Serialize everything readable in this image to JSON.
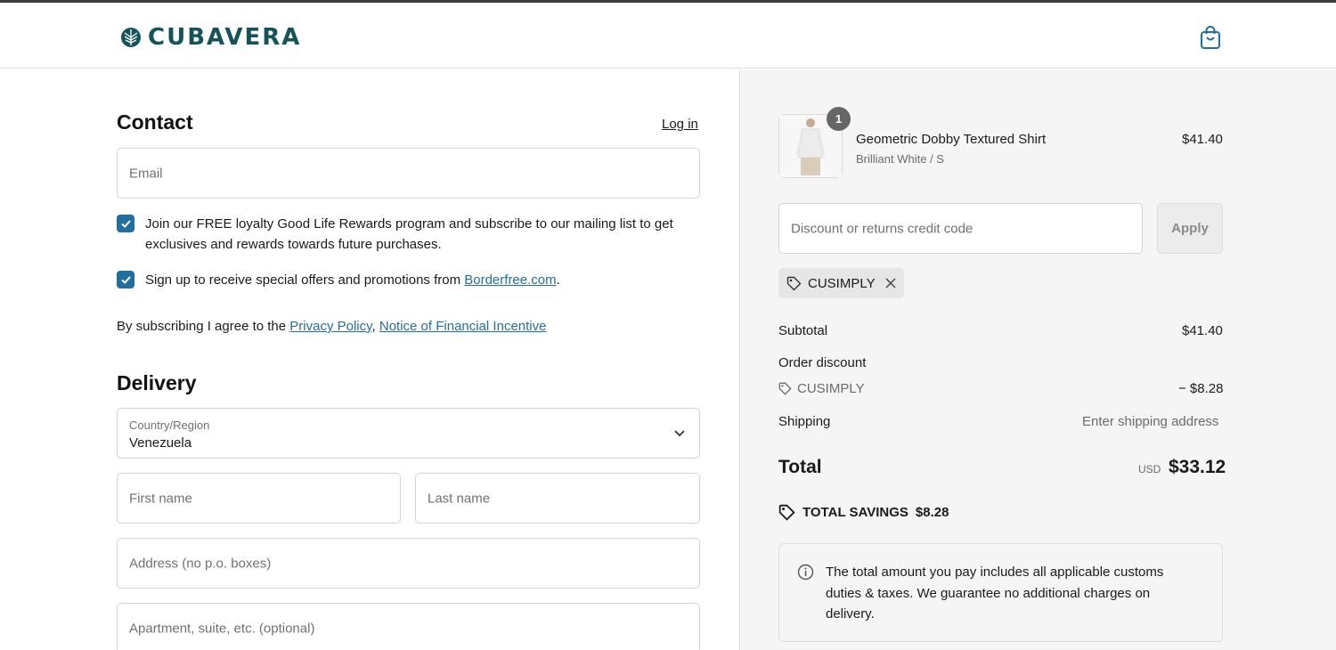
{
  "brand": {
    "name": "CUBAVERA",
    "logo_icon": "palm-leaf-icon",
    "accent": "#1f6f9f",
    "brand_color": "#14535a"
  },
  "header": {
    "cart_icon": "shopping-bag-icon"
  },
  "contact": {
    "title": "Contact",
    "login_label": "Log in",
    "email_placeholder": "Email",
    "loyalty_text": "Join our FREE loyalty Good Life Rewards program and subscribe to our mailing list to get exclusives and rewards towards future purchases.",
    "loyalty_checked": true,
    "offers_text_prefix": "Sign up to receive special offers and promotions from ",
    "offers_link": "Borderfree.com",
    "offers_text_suffix": ".",
    "offers_checked": true,
    "agree_prefix": "By subscribing I agree to the ",
    "privacy_link": "Privacy Policy",
    "separator": ",",
    "financial_link": "Notice of Financial Incentive"
  },
  "delivery": {
    "title": "Delivery",
    "country_label": "Country/Region",
    "country_value": "Venezuela",
    "first_name_placeholder": "First name",
    "last_name_placeholder": "Last name",
    "address_placeholder": "Address (no p.o. boxes)",
    "apartment_placeholder": "Apartment, suite, etc. (optional)"
  },
  "summary": {
    "item": {
      "name": "Geometric Dobby Textured Shirt",
      "variant": "Brilliant White / S",
      "price": "$41.40",
      "quantity": "1"
    },
    "discount_placeholder": "Discount or returns credit code",
    "apply_label": "Apply",
    "applied_code": "CUSIMPLY",
    "subtotal_label": "Subtotal",
    "subtotal_value": "$41.40",
    "order_discount_label": "Order discount",
    "discount_code": "CUSIMPLY",
    "discount_value": "− $8.28",
    "shipping_label": "Shipping",
    "shipping_value": "Enter shipping address",
    "total_label": "Total",
    "total_currency": "USD",
    "total_value": "$33.12",
    "savings_label": "TOTAL SAVINGS",
    "savings_value": "$8.28",
    "notice_text": "The total amount you pay includes all applicable customs duties & taxes. We guarantee no additional charges on delivery."
  }
}
